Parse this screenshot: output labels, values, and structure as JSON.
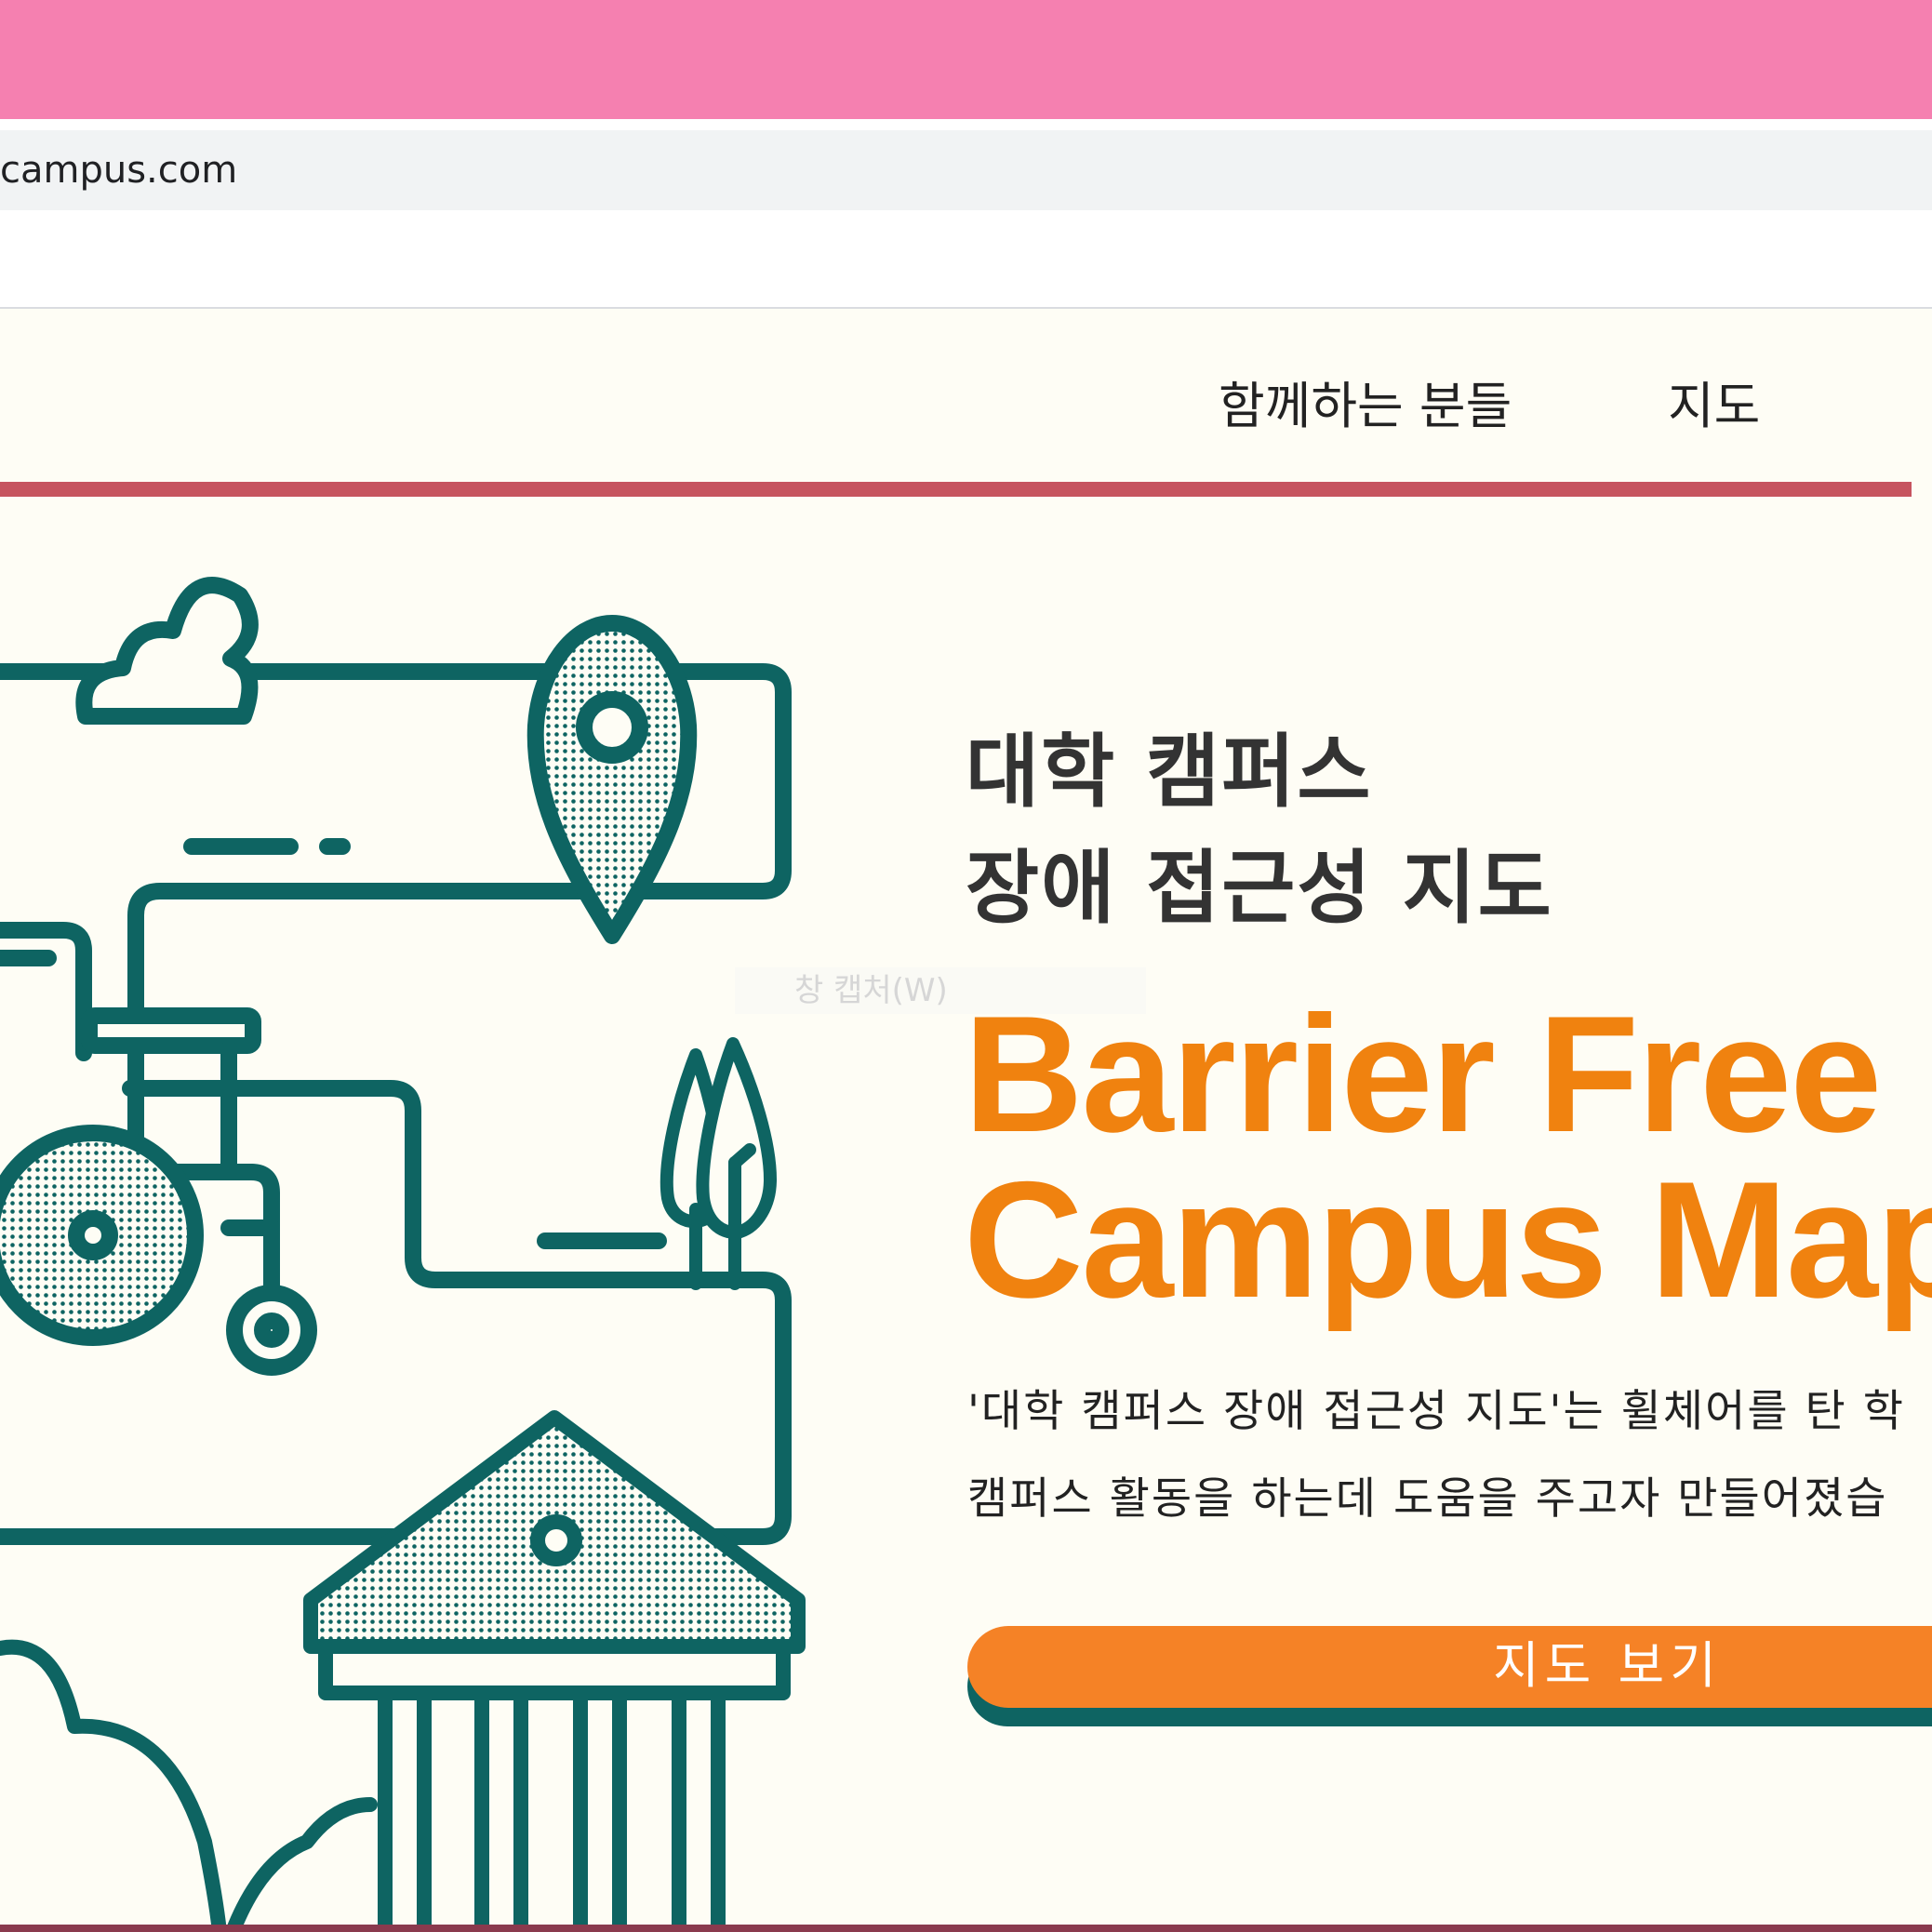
{
  "browser": {
    "url": "campus.com"
  },
  "nav": {
    "items": [
      {
        "label": "함께하는 분들"
      },
      {
        "label": "지도"
      }
    ]
  },
  "hero": {
    "title_line1": "대학 캠퍼스",
    "title_line2": "장애 접근성 지도",
    "english_line1": "Barrier Free",
    "english_line2": "Campus Map",
    "desc_line1": "'대학 캠퍼스 장애 접근성 지도'는 휠체어를 탄 학",
    "desc_line2": "캠퍼스 활동을 하는데 도움을 주고자 만들어졌습",
    "cta_label": "지도 보기"
  },
  "overlay": {
    "capture_tooltip": "창 캡처(W)"
  },
  "colors": {
    "titlebar": "#f580b0",
    "accent_orange": "#f0820f",
    "accent_teal": "#0e6462",
    "nav_divider": "#c6545f",
    "background": "#fefdf5"
  },
  "icons": [
    "cloud-icon",
    "map-pin-icon",
    "wheelchair-icon",
    "tree-icon",
    "university-building-icon",
    "bush-icon"
  ]
}
